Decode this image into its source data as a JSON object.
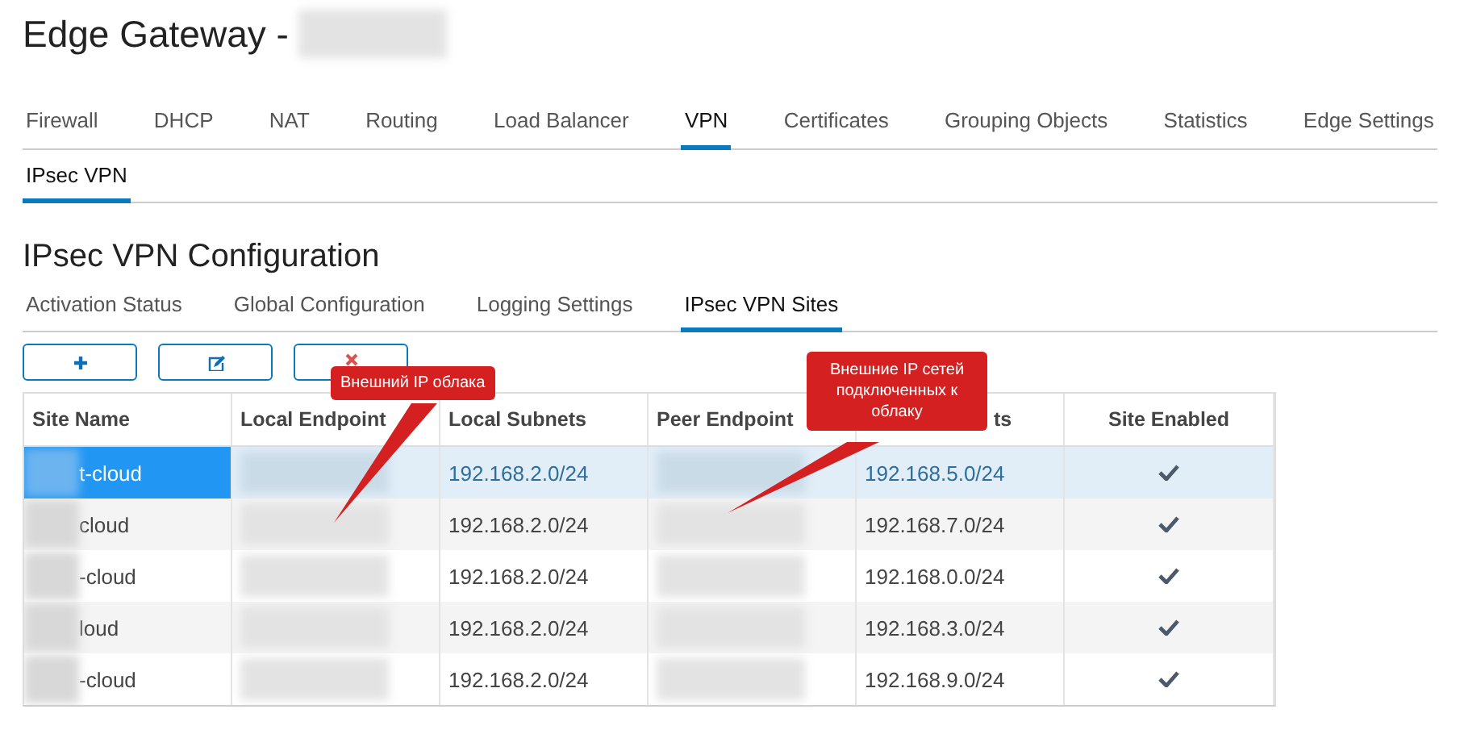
{
  "page_title": "Edge Gateway -",
  "tabs": [
    {
      "label": "Firewall",
      "selected": false
    },
    {
      "label": "DHCP",
      "selected": false
    },
    {
      "label": "NAT",
      "selected": false
    },
    {
      "label": "Routing",
      "selected": false
    },
    {
      "label": "Load Balancer",
      "selected": false
    },
    {
      "label": "VPN",
      "selected": true
    },
    {
      "label": "Certificates",
      "selected": false
    },
    {
      "label": "Grouping Objects",
      "selected": false
    },
    {
      "label": "Statistics",
      "selected": false
    },
    {
      "label": "Edge Settings",
      "selected": false
    }
  ],
  "subtabs": [
    {
      "label": "IPsec VPN",
      "selected": true
    }
  ],
  "section_title": "IPsec VPN Configuration",
  "section_tabs": [
    {
      "label": "Activation Status",
      "selected": false
    },
    {
      "label": "Global Configuration",
      "selected": false
    },
    {
      "label": "Logging Settings",
      "selected": false
    },
    {
      "label": "IPsec VPN Sites",
      "selected": true
    }
  ],
  "toolbar": [
    {
      "kind": "add"
    },
    {
      "kind": "edit"
    },
    {
      "kind": "delete"
    }
  ],
  "table": {
    "columns": [
      "Site Name",
      "Local Endpoint",
      "Local Subnets",
      "Peer Endpoint",
      "ts",
      "Site Enabled"
    ],
    "rows": [
      {
        "site_name": "t-cloud",
        "local_subnets": "192.168.2.0/24",
        "peer_subnets": "192.168.5.0/24",
        "enabled": true,
        "selected": true
      },
      {
        "site_name": "cloud",
        "local_subnets": "192.168.2.0/24",
        "peer_subnets": "192.168.7.0/24",
        "enabled": true,
        "selected": false
      },
      {
        "site_name": "-cloud",
        "local_subnets": "192.168.2.0/24",
        "peer_subnets": "192.168.0.0/24",
        "enabled": true,
        "selected": false
      },
      {
        "site_name": "loud",
        "local_subnets": "192.168.2.0/24",
        "peer_subnets": "192.168.3.0/24",
        "enabled": true,
        "selected": false
      },
      {
        "site_name": "-cloud",
        "local_subnets": "192.168.2.0/24",
        "peer_subnets": "192.168.9.0/24",
        "enabled": true,
        "selected": false
      }
    ]
  },
  "callouts": [
    {
      "text": "Внешний IP облака"
    },
    {
      "text": "Внешние IP сетей подключенных к облаку"
    }
  ]
}
